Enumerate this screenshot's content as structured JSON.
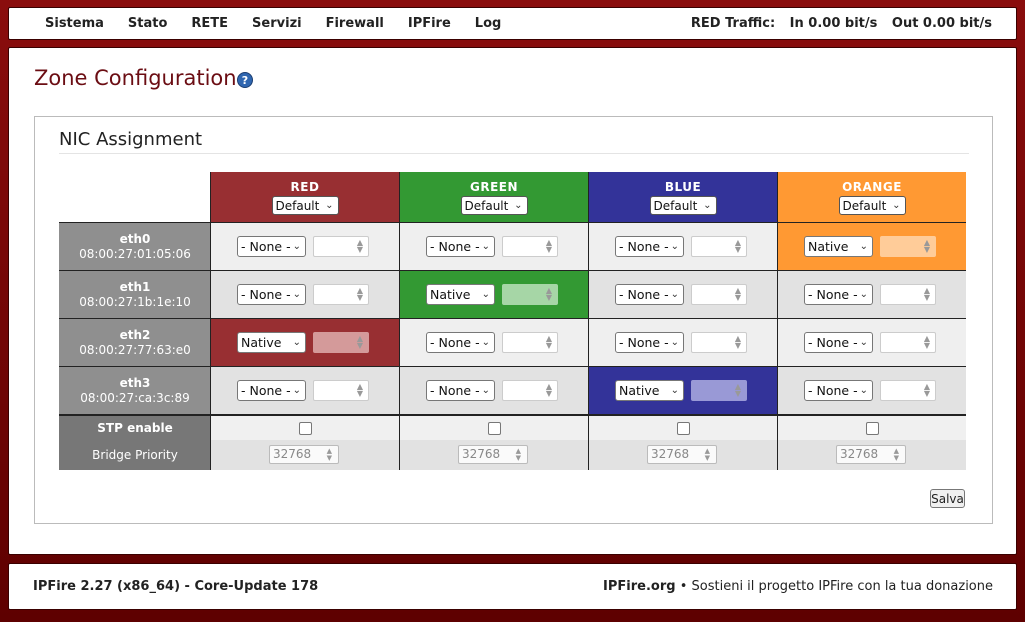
{
  "nav": {
    "items": [
      "Sistema",
      "Stato",
      "RETE",
      "Servizi",
      "Firewall",
      "IPFire",
      "Log"
    ],
    "traffic_label": "RED Traffic:",
    "traffic_in": "In 0.00 bit/s",
    "traffic_out": "Out 0.00 bit/s"
  },
  "page": {
    "title": "Zone Configuration",
    "help_icon": "?"
  },
  "section": {
    "title": "NIC Assignment"
  },
  "zones": [
    {
      "name": "RED",
      "select": "Default",
      "color": "#982f32",
      "light": "#d49a9a"
    },
    {
      "name": "GREEN",
      "select": "Default",
      "color": "#339933",
      "light": "#a6d6a6"
    },
    {
      "name": "BLUE",
      "select": "Default",
      "color": "#333399",
      "light": "#9999d6"
    },
    {
      "name": "ORANGE",
      "select": "Default",
      "color": "#ff9933",
      "light": "#ffcc99"
    }
  ],
  "nics": [
    {
      "name": "eth0",
      "mac": "08:00:27:01:05:06",
      "cells": [
        "- None -",
        "- None -",
        "- None -",
        "Native"
      ]
    },
    {
      "name": "eth1",
      "mac": "08:00:27:1b:1e:10",
      "cells": [
        "- None -",
        "Native",
        "- None -",
        "- None -"
      ]
    },
    {
      "name": "eth2",
      "mac": "08:00:27:77:63:e0",
      "cells": [
        "Native",
        "- None -",
        "- None -",
        "- None -"
      ]
    },
    {
      "name": "eth3",
      "mac": "08:00:27:ca:3c:89",
      "cells": [
        "- None -",
        "- None -",
        "Native",
        "- None -"
      ]
    }
  ],
  "stp": {
    "label": "STP enable"
  },
  "bridge": {
    "label": "Bridge Priority",
    "values": [
      "32768",
      "32768",
      "32768",
      "32768"
    ]
  },
  "save_label": "Salva",
  "footer": {
    "version": "IPFire 2.27 (x86_64) - Core-Update 178",
    "site": "IPFire.org",
    "bullet": "•",
    "donate": "Sostieni il progetto IPFire con la tua donazione"
  }
}
